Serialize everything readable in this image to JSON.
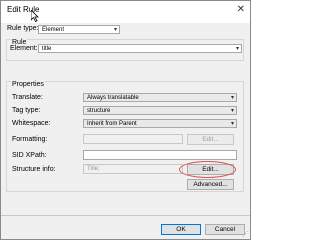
{
  "window": {
    "title": "Edit Rule",
    "close_glyph": "✕"
  },
  "rule_type": {
    "label": "Rule type:",
    "value": "Element"
  },
  "rule_group": {
    "title": "Rule",
    "element_label": "Element:",
    "element_value": "title"
  },
  "properties_group": {
    "title": "Properties",
    "translate_label": "Translate:",
    "translate_value": "Always translatable",
    "tag_type_label": "Tag type:",
    "tag_type_value": "structure",
    "whitespace_label": "Whitespace:",
    "whitespace_value": "Inherit from Parent",
    "formatting_label": "Formatting:",
    "formatting_value": "",
    "formatting_edit_label": "Edit...",
    "sid_xpath_label": "SID XPath:",
    "sid_xpath_value": "",
    "structure_info_label": "Structure info:",
    "structure_info_value": "Title;",
    "structure_info_edit_label": "Edit...",
    "advanced_label": "Advanced..."
  },
  "footer": {
    "ok_label": "OK",
    "cancel_label": "Cancel"
  },
  "icons": {
    "dropdown": "chevron-down-icon",
    "resize": "resize-grip-icon"
  },
  "colors": {
    "highlight": "#d9534f",
    "primary_border": "#0078d7"
  }
}
